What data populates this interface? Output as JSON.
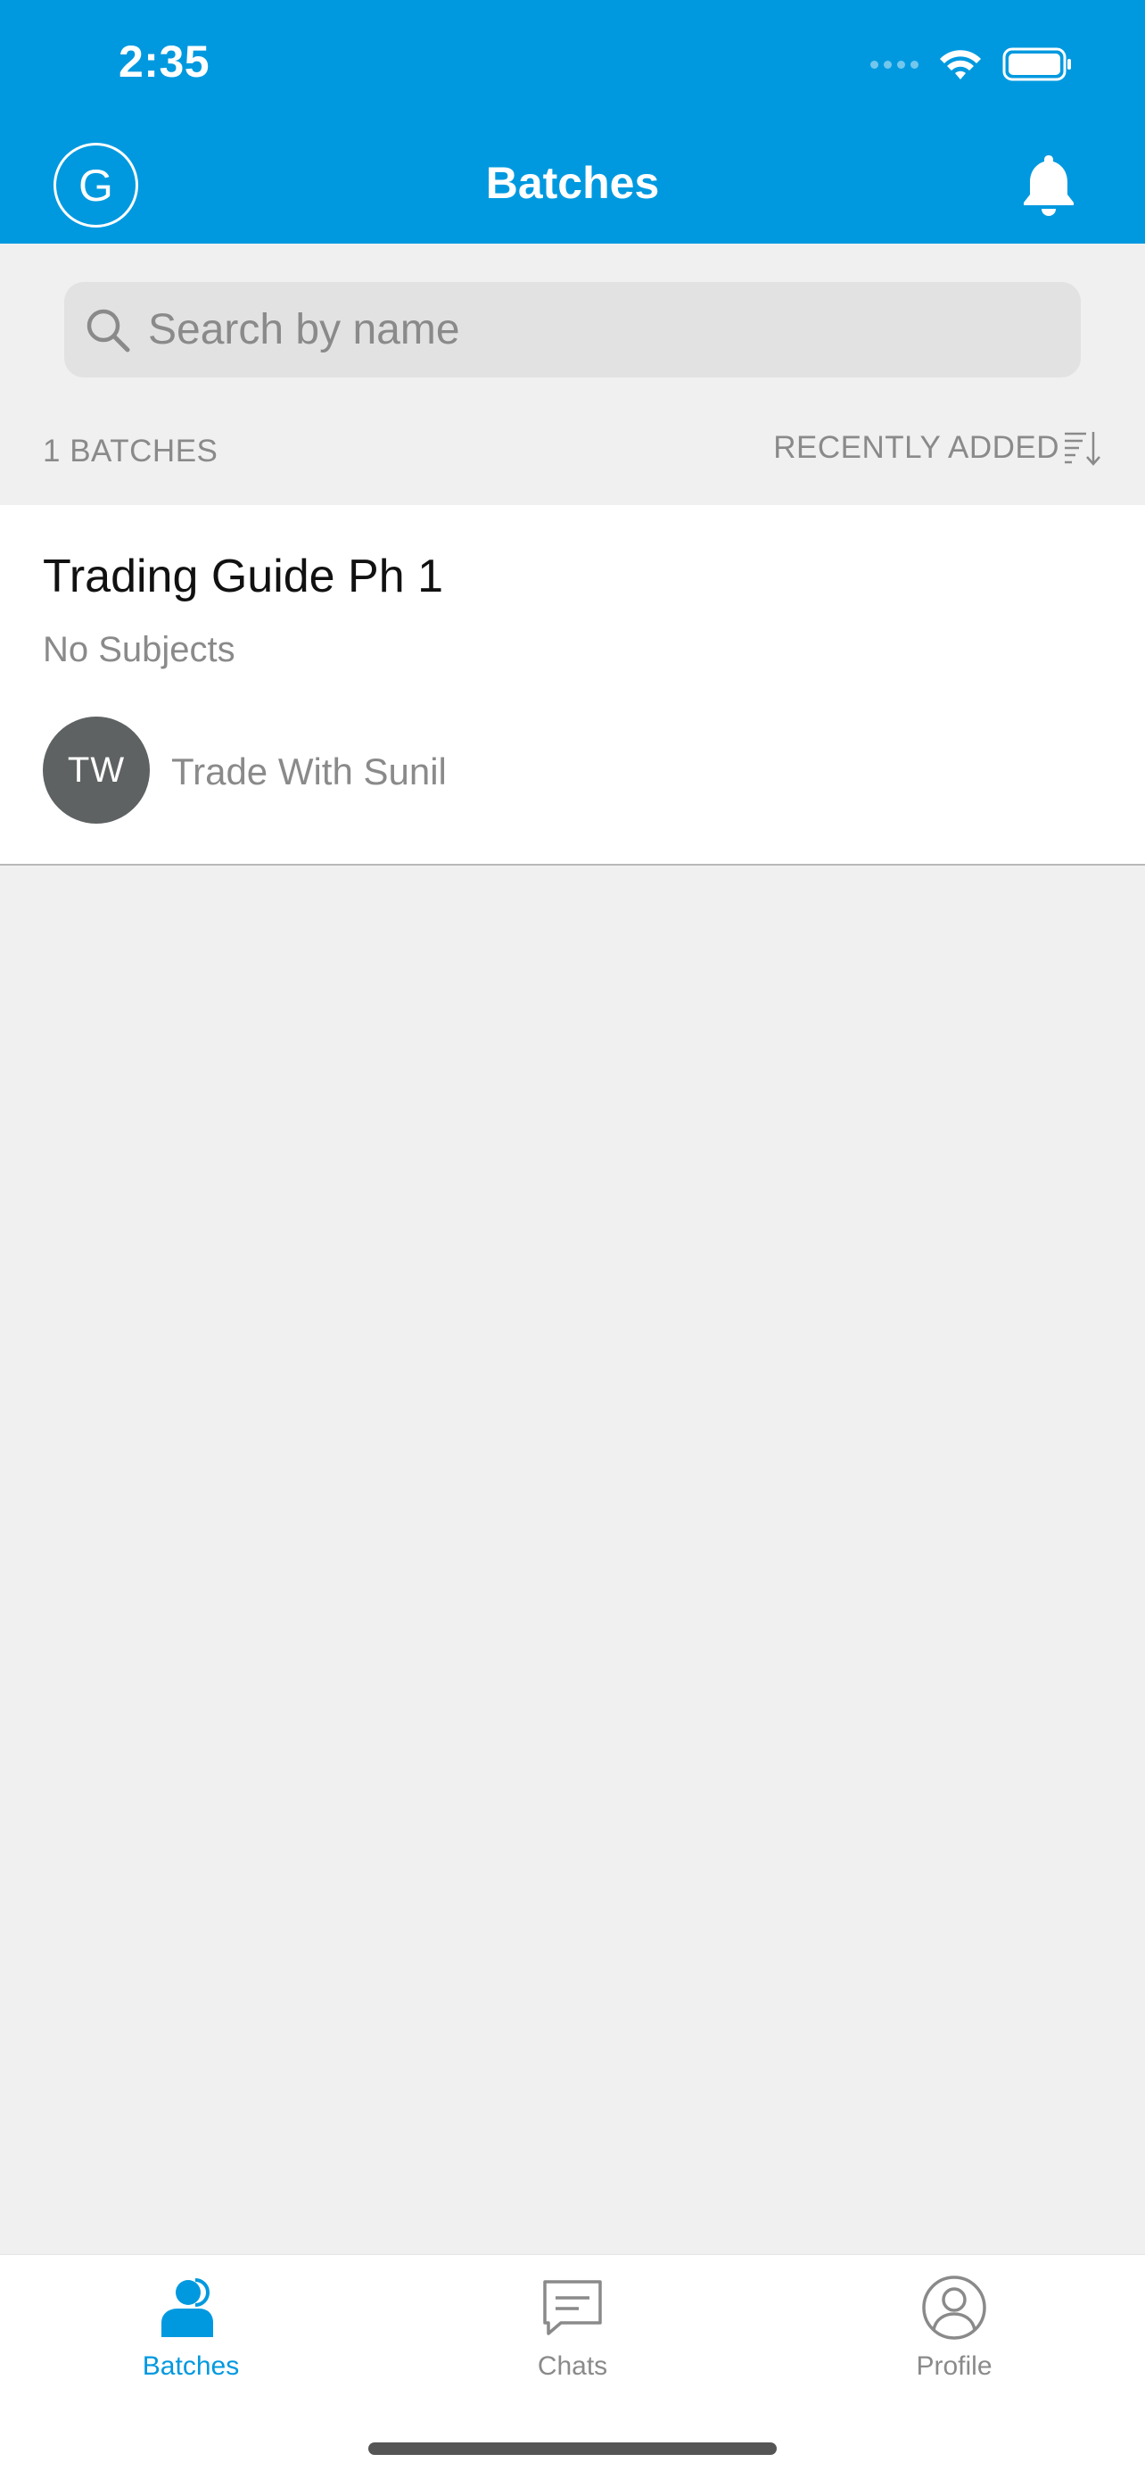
{
  "status_bar": {
    "time": "2:35"
  },
  "header": {
    "avatar_initial": "G",
    "title": "Batches"
  },
  "search": {
    "placeholder": "Search by name",
    "value": ""
  },
  "list": {
    "count_label": "1 BATCHES",
    "sort_label": "RECENTLY ADDED",
    "items": [
      {
        "title": "Trading Guide Ph 1",
        "subtitle": "No Subjects",
        "owner_initials": "TW",
        "owner_name": "Trade With Sunil"
      }
    ]
  },
  "tabbar": {
    "tabs": [
      {
        "label": "Batches",
        "icon": "users-icon",
        "active": true
      },
      {
        "label": "Chats",
        "icon": "chat-icon",
        "active": false
      },
      {
        "label": "Profile",
        "icon": "profile-icon",
        "active": false
      }
    ]
  },
  "colors": {
    "brand": "#0099df",
    "background": "#f0f0f0",
    "muted_text": "#8a8a8a",
    "owner_avatar": "#5f6263"
  }
}
